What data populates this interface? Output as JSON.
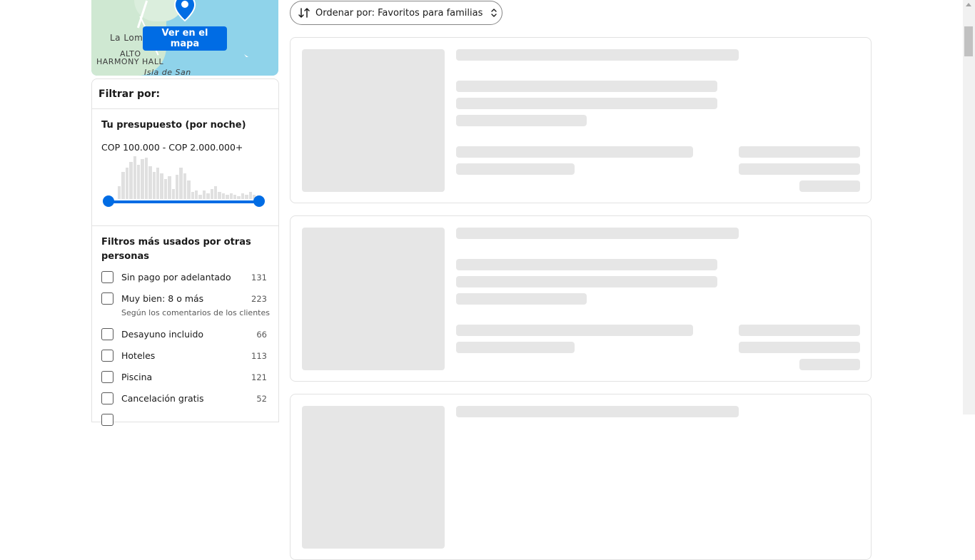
{
  "map": {
    "labels": [
      "La Lom",
      "ALTO",
      "HARMONY HALL",
      "Isla de San"
    ],
    "button_label": "Ver en el mapa",
    "pin_icon": "location-pin-icon"
  },
  "filters": {
    "header": "Filtrar por:",
    "budget": {
      "title": "Tu presupuesto (por noche)",
      "range": "COP 100.000 - COP 2.000.000+",
      "min_fraction": 0.0,
      "max_fraction": 1.0
    },
    "popular": {
      "title": "Filtros más usados por otras personas",
      "items": [
        {
          "label": "Sin pago por adelantado",
          "count": "131",
          "checked": false
        },
        {
          "label": "Muy bien: 8 o más",
          "count": "223",
          "sublabel": "Según los comentarios de los clientes",
          "checked": false
        },
        {
          "label": "Desayuno incluido",
          "count": "66",
          "checked": false
        },
        {
          "label": "Hoteles",
          "count": "113",
          "checked": false
        },
        {
          "label": "Piscina",
          "count": "121",
          "checked": false
        },
        {
          "label": "Cancelación gratis",
          "count": "52",
          "checked": false
        }
      ]
    }
  },
  "sort": {
    "label": "Ordenar por: Favoritos para familias",
    "icon": "sort-arrows-icon",
    "chevron_icon": "chevron-updown-icon"
  },
  "colors": {
    "accent": "#006ce4",
    "skeleton": "#e6e6e6",
    "border": "#e2e2e2"
  }
}
